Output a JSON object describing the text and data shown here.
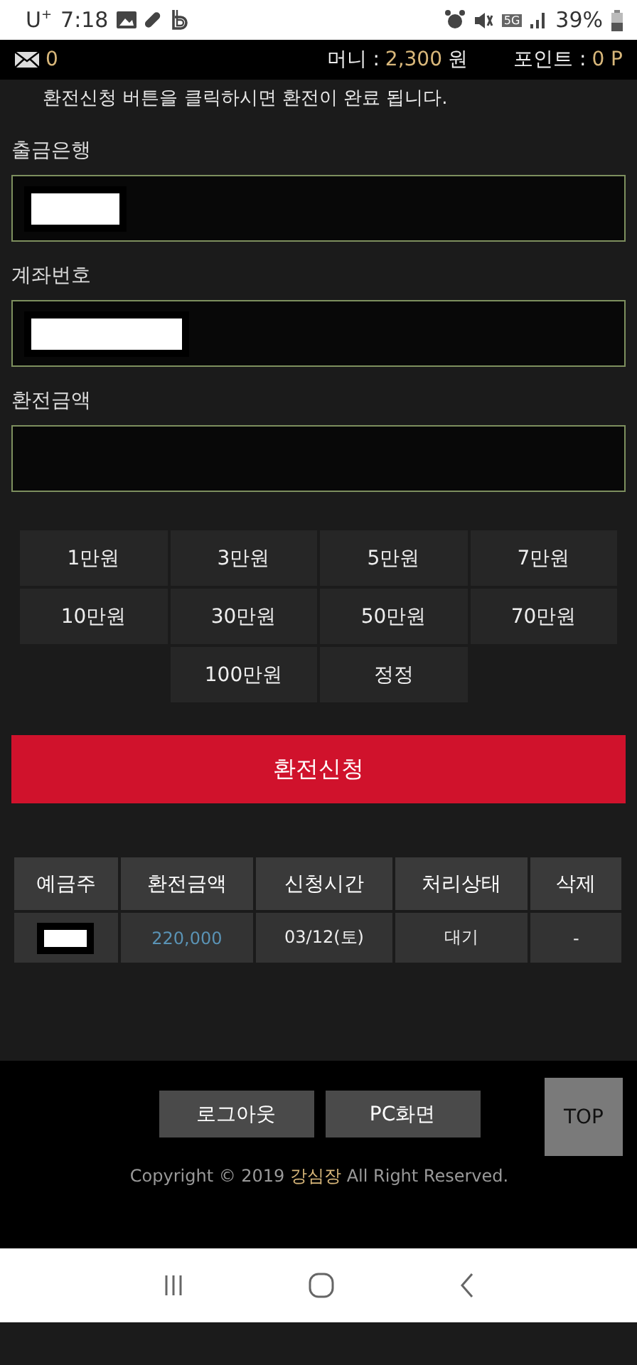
{
  "status_bar": {
    "carrier": "U$^{+}$",
    "time": "7:18",
    "network": "5G",
    "battery": "39%"
  },
  "header": {
    "messages": "0",
    "money_label": "머니 :",
    "money": "2,300",
    "money_unit": "원",
    "points_label": "포인트 :",
    "points": "0 P"
  },
  "notice": "환전신청 버튼을 클릭하시면 환전이 완료 됩니다.",
  "fields": [
    {
      "label": "출금은행",
      "redacted": true
    },
    {
      "label": "계좌번호",
      "redacted": true
    },
    {
      "label": "환전금액",
      "redacted": false
    }
  ],
  "amount_buttons": [
    "1만원",
    "3만원",
    "5만원",
    "7만원",
    "10만원",
    "30만원",
    "50만원",
    "70만원",
    "100만원",
    "정정"
  ],
  "submit_button": "환전신청",
  "table": {
    "columns": [
      "예금주",
      "환전금액",
      "신청시간",
      "처리상태",
      "삭제"
    ],
    "rows": [
      {
        "depositor_redacted": true,
        "amount": "220,000",
        "time": "03/12(토)",
        "status": "대기",
        "delete": "-"
      }
    ]
  },
  "footer": {
    "buttons": [
      "로그아웃",
      "PC화면"
    ],
    "top_button": "TOP",
    "copyright": "Copyright © 2019 **강심장** All Right Reserved."
  }
}
